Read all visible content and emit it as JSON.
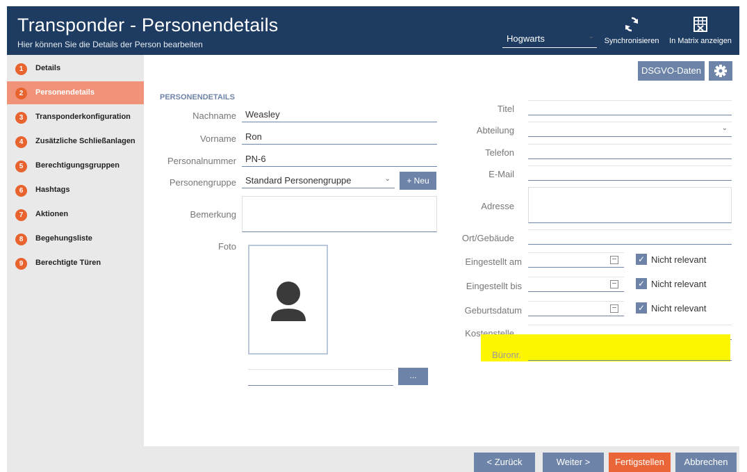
{
  "header": {
    "title": "Transponder - Personendetails",
    "subtitle": "Hier können Sie die Details der Person bearbeiten",
    "site_value": "Hogwarts",
    "sync_label": "Synchronisieren",
    "matrix_label": "In Matrix anzeigen"
  },
  "sidebar": {
    "items": [
      {
        "num": "1",
        "label": "Details"
      },
      {
        "num": "2",
        "label": "Personendetails"
      },
      {
        "num": "3",
        "label": "Transponderkonfiguration"
      },
      {
        "num": "4",
        "label": "Zusätzliche Schließanlagen"
      },
      {
        "num": "5",
        "label": "Berechtigungsgruppen"
      },
      {
        "num": "6",
        "label": "Hashtags"
      },
      {
        "num": "7",
        "label": "Aktionen"
      },
      {
        "num": "8",
        "label": "Begehungsliste"
      },
      {
        "num": "9",
        "label": "Berechtigte Türen"
      }
    ]
  },
  "toolbar": {
    "dsgvo_label": "DSGVO-Daten"
  },
  "form": {
    "section_title": "PERSONENDETAILS",
    "nachname_label": "Nachname",
    "nachname_value": "Weasley",
    "vorname_label": "Vorname",
    "vorname_value": "Ron",
    "personalnummer_label": "Personalnummer",
    "personalnummer_value": "PN-6",
    "personengruppe_label": "Personengruppe",
    "personengruppe_value": "Standard Personengruppe",
    "neu_label": "+ Neu",
    "bemerkung_label": "Bemerkung",
    "foto_label": "Foto",
    "photo_browse_label": "..."
  },
  "right_form": {
    "titel_label": "Titel",
    "abteilung_label": "Abteilung",
    "telefon_label": "Telefon",
    "email_label": "E-Mail",
    "adresse_label": "Adresse",
    "ort_label": "Ort/Gebäude",
    "eingestellt_am_label": "Eingestellt am",
    "eingestellt_bis_label": "Eingestellt bis",
    "geburtsdatum_label": "Geburtsdatum",
    "nicht_relevant_label": "Nicht relevant",
    "kostenstelle_label": "Kostenstelle",
    "bueronr_label": "Büronr."
  },
  "footer": {
    "back_label": "< Zurück",
    "next_label": "Weiter >",
    "finish_label": "Fertigstellen",
    "cancel_label": "Abbrechen"
  },
  "colors": {
    "header_bg": "#1e3c61",
    "accent_orange": "#e8632e",
    "button_blue": "#6d84a8",
    "highlight_yellow": "#fef600"
  }
}
